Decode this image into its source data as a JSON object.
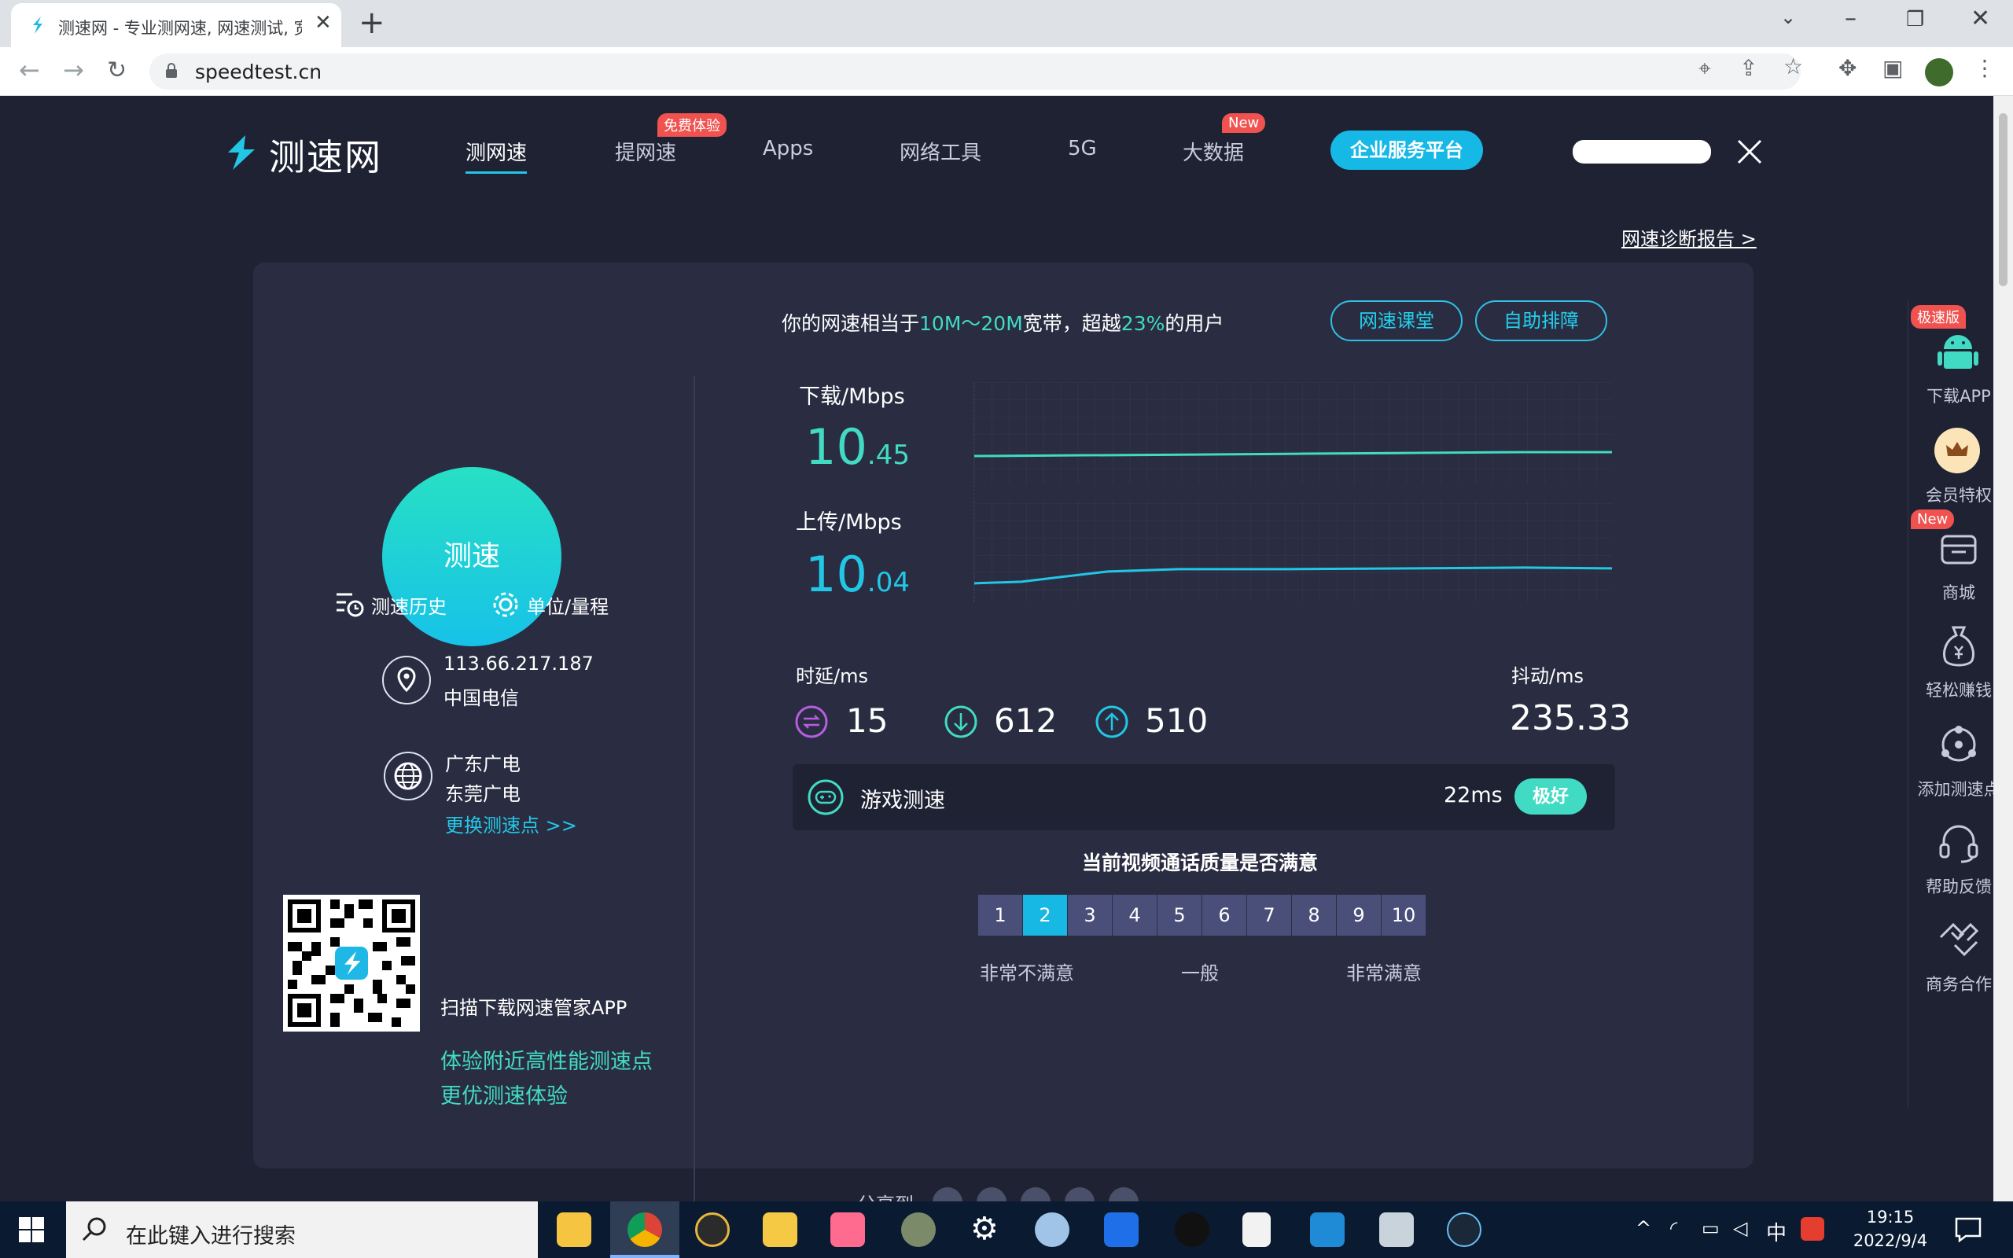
{
  "browser": {
    "tab_title": "测速网 - 专业测网速, 网速测试, 宽",
    "tab_close": "✕",
    "new_tab": "+",
    "url": "speedtest.cn"
  },
  "site": {
    "logo_text": "测速网",
    "nav": [
      "测网速",
      "提网速",
      "Apps",
      "网络工具",
      "5G",
      "大数据"
    ],
    "badge_free": "免费体验",
    "badge_new": "New",
    "enterprise_button": "企业服务平台",
    "report_link": "网速诊断报告 >"
  },
  "left_panel": {
    "start_button": "测速",
    "history": "测速历史",
    "unit": "单位/量程",
    "ip": "113.66.217.187",
    "isp": "中国电信",
    "server_line1": "广东广电",
    "server_line2": "东莞广电",
    "change_server": "更换测速点 >>",
    "qr_title": "扫描下载网速管家APP",
    "qr_line1": "体验附近高性能测速点",
    "qr_line2": "更优测速体验"
  },
  "result": {
    "summary_prefix": "你的网速相当于",
    "summary_band": "10M～20M",
    "summary_mid": "宽带，超越",
    "summary_pct": "23%",
    "summary_suffix": "的用户",
    "class_button": "网速课堂",
    "troubleshoot_button": "自助排障",
    "download_label": "下载/Mbps",
    "download_int": "10",
    "download_dec": ".45",
    "upload_label": "上传/Mbps",
    "upload_int": "10",
    "upload_dec": ".04",
    "latency_label": "时延/ms",
    "latency": "15",
    "latency_down": "612",
    "latency_up": "510",
    "jitter_label": "抖动/ms",
    "jitter": "235.33",
    "game_label": "游戏测速",
    "game_ms": "22ms",
    "game_grade": "极好",
    "survey_title": "当前视频通话质量是否满意",
    "survey_options": [
      "1",
      "2",
      "3",
      "4",
      "5",
      "6",
      "7",
      "8",
      "9",
      "10"
    ],
    "survey_selected": 2,
    "survey_low": "非常不满意",
    "survey_mid": "一般",
    "survey_high": "非常满意",
    "share_label": "分享到"
  },
  "sidebar": {
    "fast_badge": "极速版",
    "new_badge": "New",
    "items": [
      "下载APP",
      "会员特权",
      "商城",
      "轻松赚钱",
      "添加测速点",
      "帮助反馈",
      "商务合作"
    ]
  },
  "taskbar": {
    "search_placeholder": "在此键入进行搜索",
    "time": "19:15",
    "date": "2022/9/4",
    "ime": "中"
  },
  "colors": {
    "accent_teal": "#41dbc4",
    "accent_blue": "#22c7e6",
    "page_bg": "#1e2233",
    "card_bg": "#2a2d42"
  }
}
